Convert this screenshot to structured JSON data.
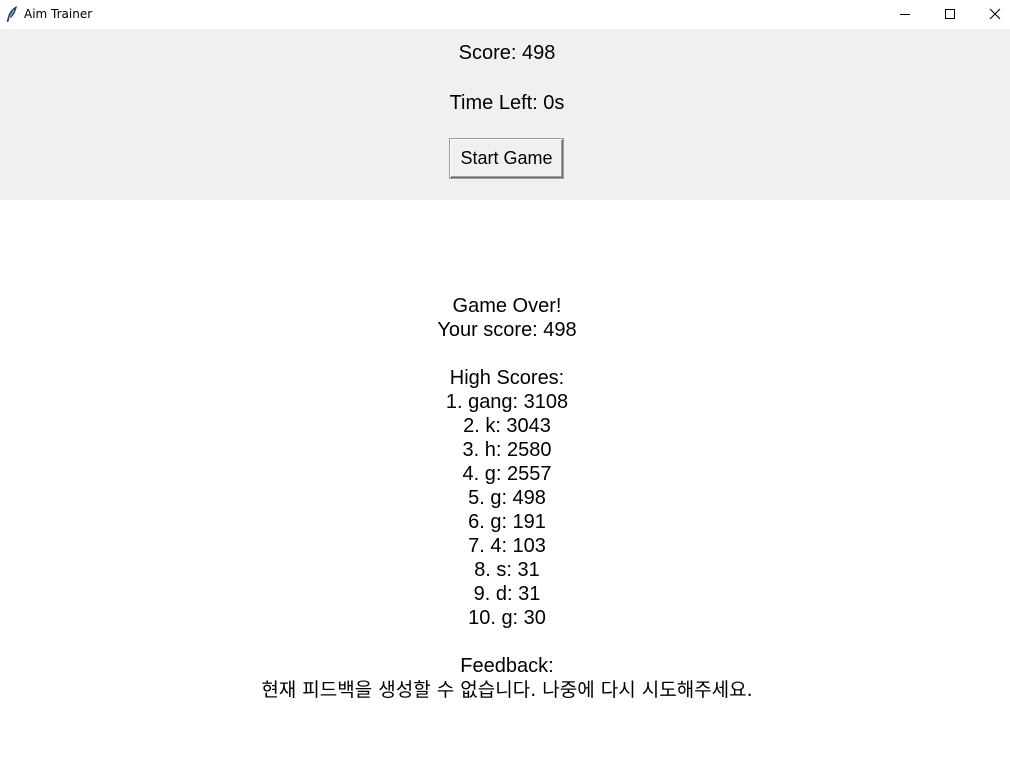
{
  "window": {
    "title": "Aim Trainer",
    "icon": "feather-icon"
  },
  "controls": {
    "score_text": "Score: 498",
    "time_text": "Time Left: 0s",
    "start_button_label": "Start Game"
  },
  "result": {
    "game_over": "Game Over!",
    "your_score": "Your score: 498",
    "high_scores_heading": "High Scores:",
    "high_scores": [
      "1. gang: 3108",
      "2. k: 3043",
      "3. h: 2580",
      "4. g: 2557",
      "5. g: 498",
      "6. g: 191",
      "7. 4: 103",
      "8. s: 31",
      "9. d: 31",
      "10. g: 30"
    ],
    "feedback_heading": "Feedback:",
    "feedback_text": "현재 피드백을 생성할 수 없습니다. 나중에 다시 시도해주세요."
  }
}
